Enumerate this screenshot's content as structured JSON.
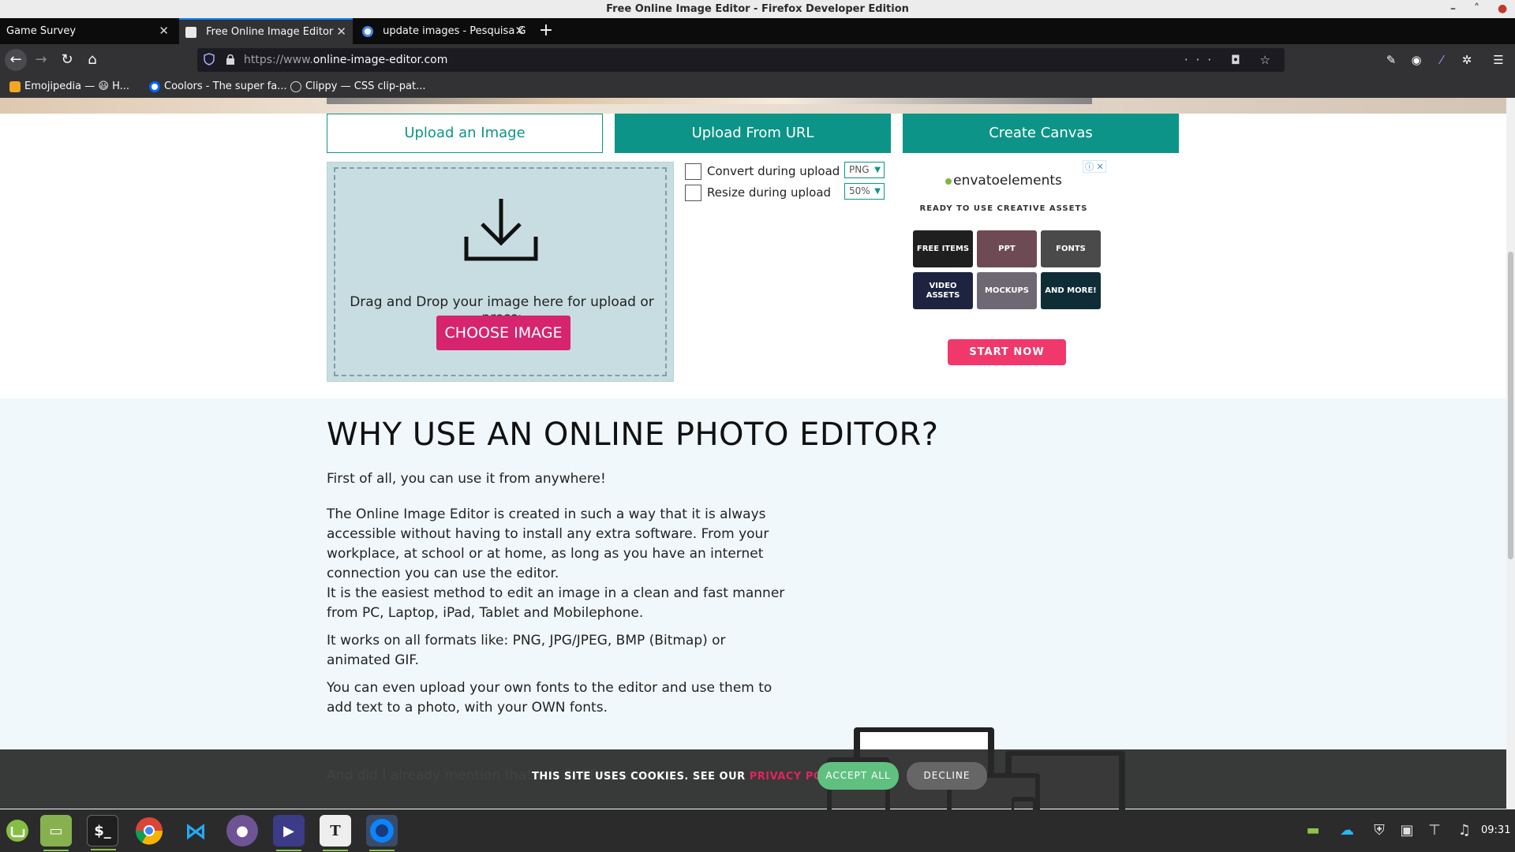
{
  "window": {
    "title": "Free Online Image Editor - Firefox Developer Edition"
  },
  "tabs": [
    {
      "label": "Game Survey",
      "active": false
    },
    {
      "label": "Free Online Image Editor",
      "active": true
    },
    {
      "label": "update images - Pesquisa G",
      "active": false
    }
  ],
  "navbar": {
    "url_prefix": "https://www.",
    "url_domain": "online-image-editor.com",
    "urlbar_icons": "··· ◘ ☆"
  },
  "bookmarks": [
    {
      "label": "Emojipedia — 😃 H..."
    },
    {
      "label": "Coolors - The super fa..."
    },
    {
      "label": "Clippy — CSS clip-pat..."
    }
  ],
  "upload_tabs": {
    "upload_image": "Upload an Image",
    "upload_url": "Upload From URL",
    "create_canvas": "Create Canvas"
  },
  "dropzone": {
    "text": "Drag and Drop your image here for upload or press:",
    "button": "CHOOSE IMAGE"
  },
  "options": {
    "convert_label": "Convert during upload",
    "convert_value": "PNG",
    "resize_label": "Resize during upload",
    "resize_value": "50%"
  },
  "ad": {
    "badge": "ⓘ ✕",
    "logo": "envatoelements",
    "tagline": "READY TO USE CREATIVE ASSETS",
    "tiles": [
      "FREE ITEMS",
      "PPT",
      "FONTS",
      "VIDEO ASSETS",
      "MOCKUPS",
      "AND MORE!"
    ],
    "cta": "START NOW"
  },
  "article": {
    "heading": "WHY USE AN ONLINE PHOTO EDITOR?",
    "paragraphs": [
      "First of all, you can use it from anywhere!",
      "The Online Image Editor is created in such a way that it is always accessible without having to install any extra software. From your workplace, at school or at home, as long as you have an internet connection you can use the editor.",
      "It is the easiest method to edit an image in a clean and fast manner from PC, Laptop, iPad, Tablet and Mobilephone.",
      "It works on all formats like: PNG, JPG/JPEG, BMP (Bitmap) or animated GIF.",
      "You can even upload your own fonts to the editor and use them to add text to a photo, with your OWN fonts."
    ],
    "partial_line": "And did I already mention that it is FREE to use? :-)"
  },
  "cookie": {
    "text": "THIS SITE USES COOKIES. SEE OUR ",
    "link": "PRIVACY POLICY",
    "accept": "ACCEPT ALL",
    "decline": "DECLINE"
  },
  "taskbar": {
    "clock": "09:31"
  }
}
